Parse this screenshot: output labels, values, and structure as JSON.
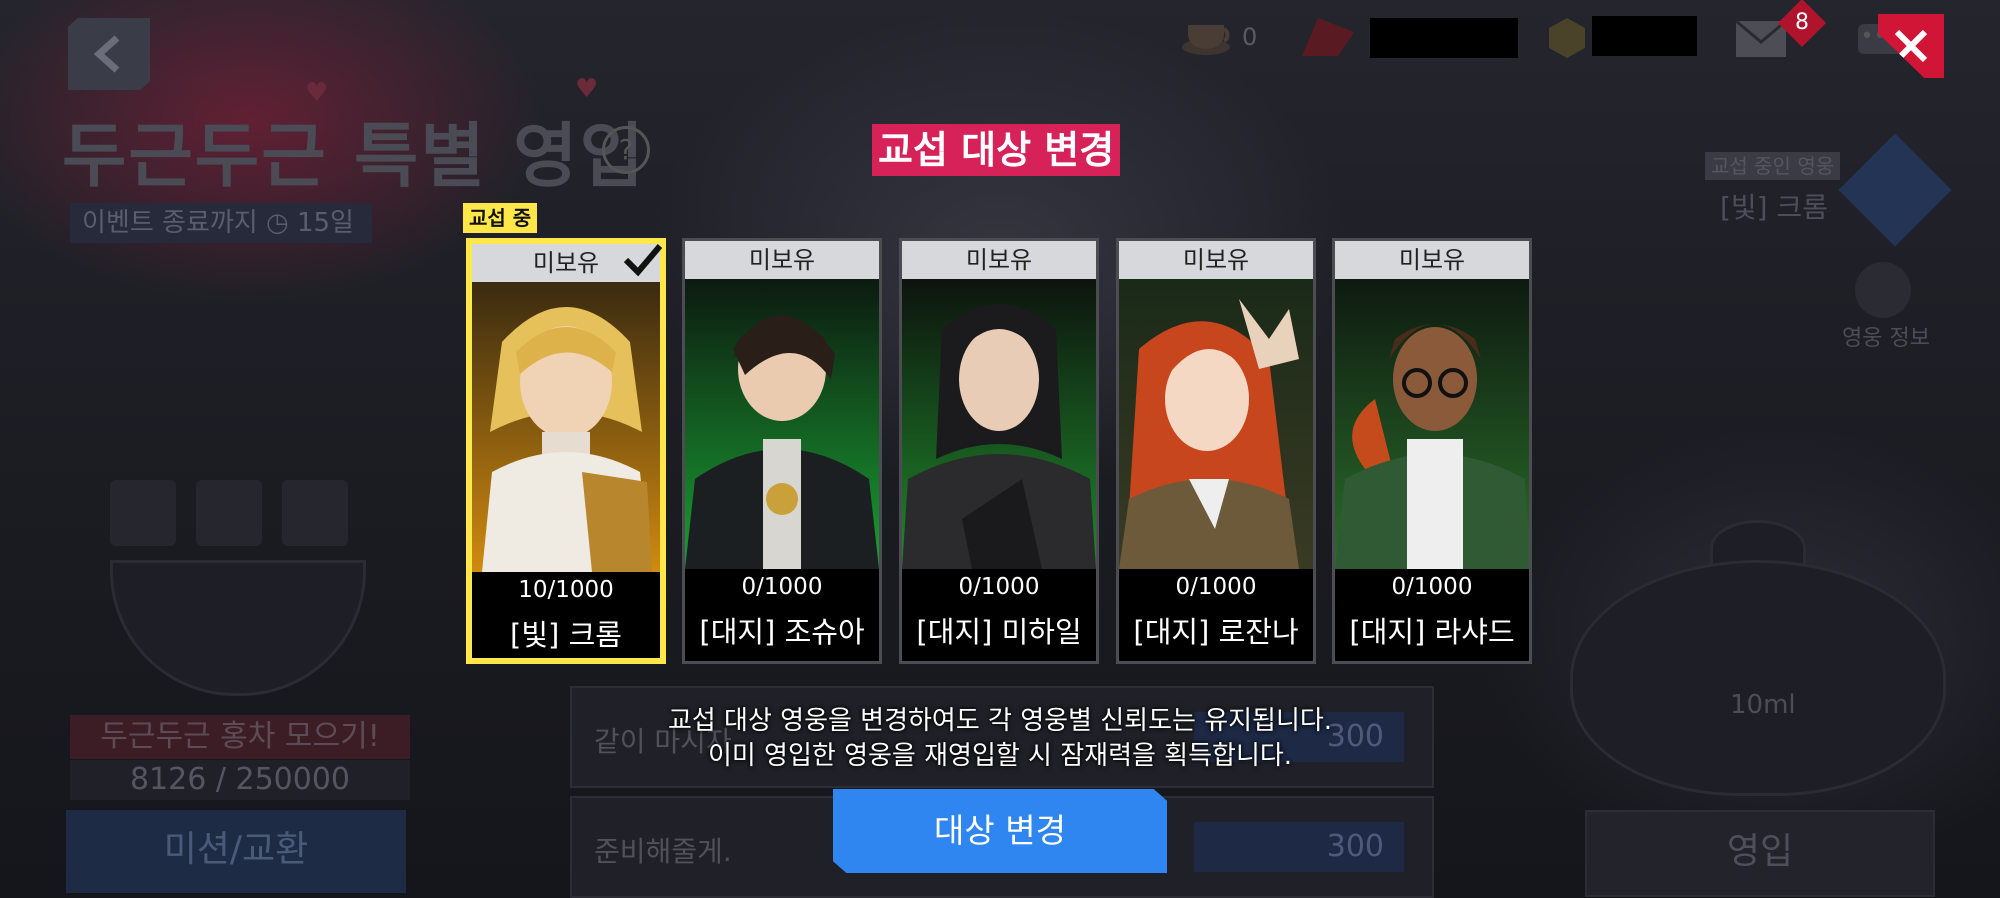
{
  "background": {
    "event_title": "두근두근 특별 영입",
    "event_remaining": "이벤트 종료까지",
    "event_days": "15일",
    "collect_title": "두근두근 홍차 모으기!",
    "collect_count": "8126 / 250000",
    "mission_button": "미션/교환",
    "row1_text": "같이 마시자",
    "row1_cost": "300",
    "row2_text": "준비해줄게.",
    "row2_cost": "300",
    "recruit_button": "영입",
    "teapot_label": "10ml",
    "current_hero_tag": "교섭 중인 영웅",
    "current_hero_name": "[빛] 크롬",
    "hero_info_label": "영웅 정보"
  },
  "topbar": {
    "tea_count": "0",
    "mail_badge": "8"
  },
  "modal": {
    "title": "교섭 대상 변경",
    "negotiating_tag": "교섭 중",
    "cards": [
      {
        "status": "미보유",
        "progress": "10/1000",
        "name": "[빛] 크롬",
        "selected": true
      },
      {
        "status": "미보유",
        "progress": "0/1000",
        "name": "[대지] 조슈아",
        "selected": false
      },
      {
        "status": "미보유",
        "progress": "0/1000",
        "name": "[대지] 미하일",
        "selected": false
      },
      {
        "status": "미보유",
        "progress": "0/1000",
        "name": "[대지] 로잔나",
        "selected": false
      },
      {
        "status": "미보유",
        "progress": "0/1000",
        "name": "[대지] 라샤드",
        "selected": false
      }
    ],
    "info_line1": "교섭 대상 영웅을 변경하여도 각 영웅별 신뢰도는 유지됩니다.",
    "info_line2": "이미 영입한 영웅을 재영입할 시 잠재력을 획득합니다.",
    "change_button": "대상 변경"
  },
  "colors": {
    "title_pink": "#d62159",
    "selected_yellow": "#ffe74a",
    "button_blue": "#2f86f0",
    "close_red": "#d01536"
  }
}
